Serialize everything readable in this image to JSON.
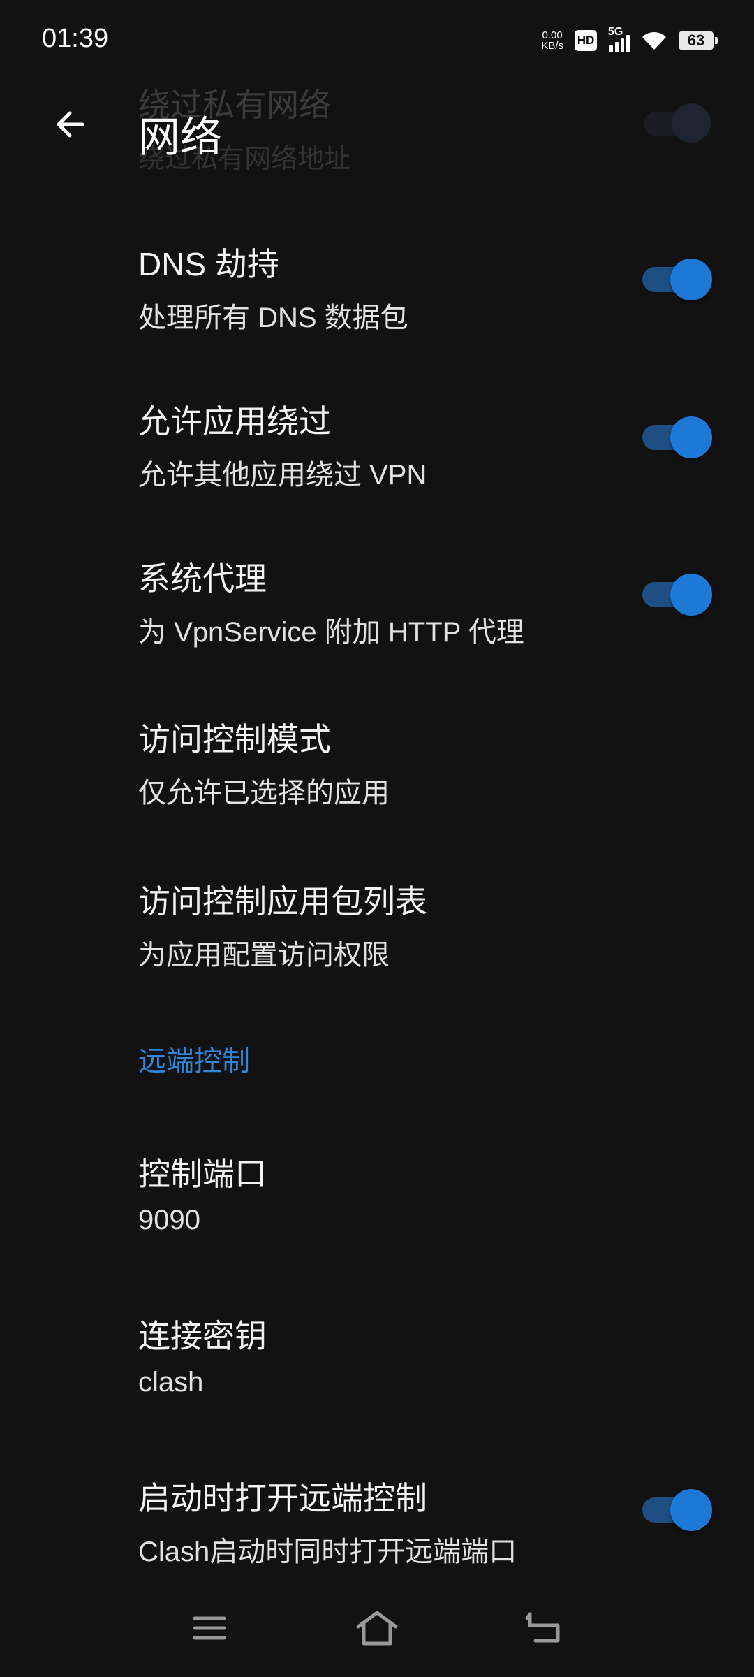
{
  "status_bar": {
    "time": "01:39",
    "net_speed_value": "0.00",
    "net_speed_unit": "KB/s",
    "hd": "HD",
    "network": "5G",
    "battery": "63"
  },
  "header": {
    "title": "网络",
    "back_icon": "arrow-left-icon"
  },
  "faded_item": {
    "title": "绕过私有网络",
    "subtitle": "绕过私有网络地址"
  },
  "settings": [
    {
      "title": "DNS 劫持",
      "subtitle": "处理所有 DNS 数据包",
      "toggle": true
    },
    {
      "title": "允许应用绕过",
      "subtitle": "允许其他应用绕过 VPN",
      "toggle": true
    },
    {
      "title": "系统代理",
      "subtitle": "为 VpnService 附加 HTTP 代理",
      "toggle": true
    },
    {
      "title": "访问控制模式",
      "subtitle": "仅允许已选择的应用"
    },
    {
      "title": "访问控制应用包列表",
      "subtitle": "为应用配置访问权限"
    }
  ],
  "remote_section": {
    "header": "远端控制",
    "items": [
      {
        "title": "控制端口",
        "subtitle": "9090"
      },
      {
        "title": "连接密钥",
        "subtitle": "clash"
      },
      {
        "title": "启动时打开远端控制",
        "subtitle": "Clash启动时同时打开远端端口",
        "toggle": true
      }
    ]
  },
  "colors": {
    "background": "#121213",
    "accent": "#1e78d6",
    "toggle_track": "#1f4f82",
    "section_header": "#2f86da"
  },
  "nav_bar": {
    "icons": [
      "menu-icon",
      "home-icon",
      "back-icon"
    ]
  }
}
